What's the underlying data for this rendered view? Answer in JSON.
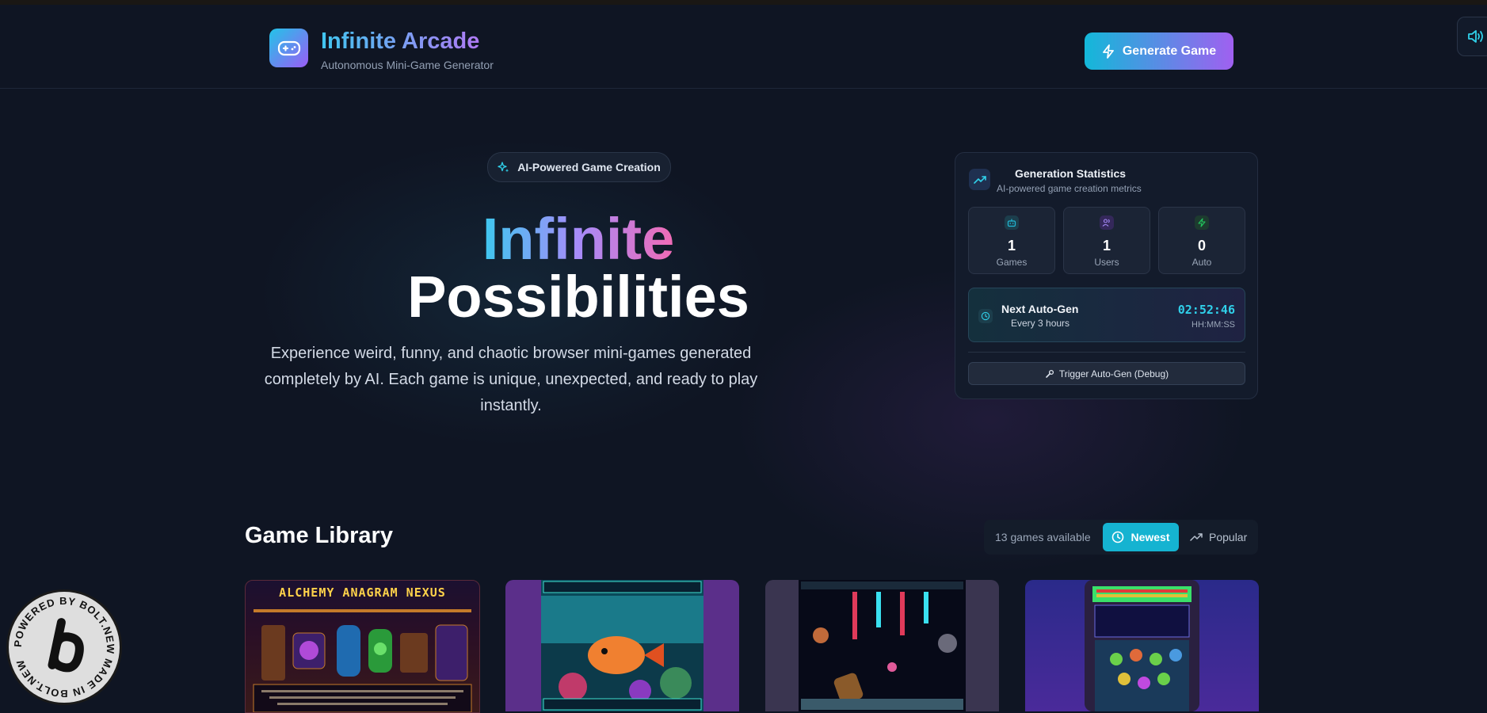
{
  "header": {
    "brand_title": "Infinite Arcade",
    "brand_subtitle": "Autonomous Mini-Game Generator",
    "generate_button": "Generate Game"
  },
  "hero": {
    "pill_label": "AI-Powered Game Creation",
    "title_line1": "Infinite",
    "title_line2": "Possibilities",
    "description": "Experience weird, funny, and chaotic browser mini-games generated completely by AI. Each game is unique, unexpected, and ready to play instantly."
  },
  "stats": {
    "title": "Generation Statistics",
    "subtitle": "AI-powered game creation metrics",
    "tiles": [
      {
        "value": "1",
        "label": "Games",
        "icon": "robot-icon",
        "color": "#22b8d6"
      },
      {
        "value": "1",
        "label": "Users",
        "icon": "users-icon",
        "color": "#a78bfa"
      },
      {
        "value": "0",
        "label": "Auto",
        "icon": "zap-icon",
        "color": "#22c55e"
      }
    ],
    "autogen": {
      "title": "Next Auto-Gen",
      "subtitle": "Every 3 hours",
      "countdown": "02:52:46",
      "format": "HH:MM:SS"
    },
    "trigger_button": "Trigger Auto-Gen (Debug)"
  },
  "library": {
    "title": "Game Library",
    "count": "13 games available",
    "sort_newest": "Newest",
    "sort_popular": "Popular",
    "active_sort": "Newest",
    "cards": [
      {
        "title": "ALCHEMY ANAGRAM NEXUS"
      },
      {
        "title": ""
      },
      {
        "title": ""
      },
      {
        "title": ""
      }
    ]
  },
  "badge": {
    "text": "POWERED BY BOLT.NEW MADE IN BOLT.NEW"
  },
  "colors": {
    "background": "#0f1523",
    "accent_cyan": "#15b3d1",
    "accent_purple": "#a060f0"
  }
}
